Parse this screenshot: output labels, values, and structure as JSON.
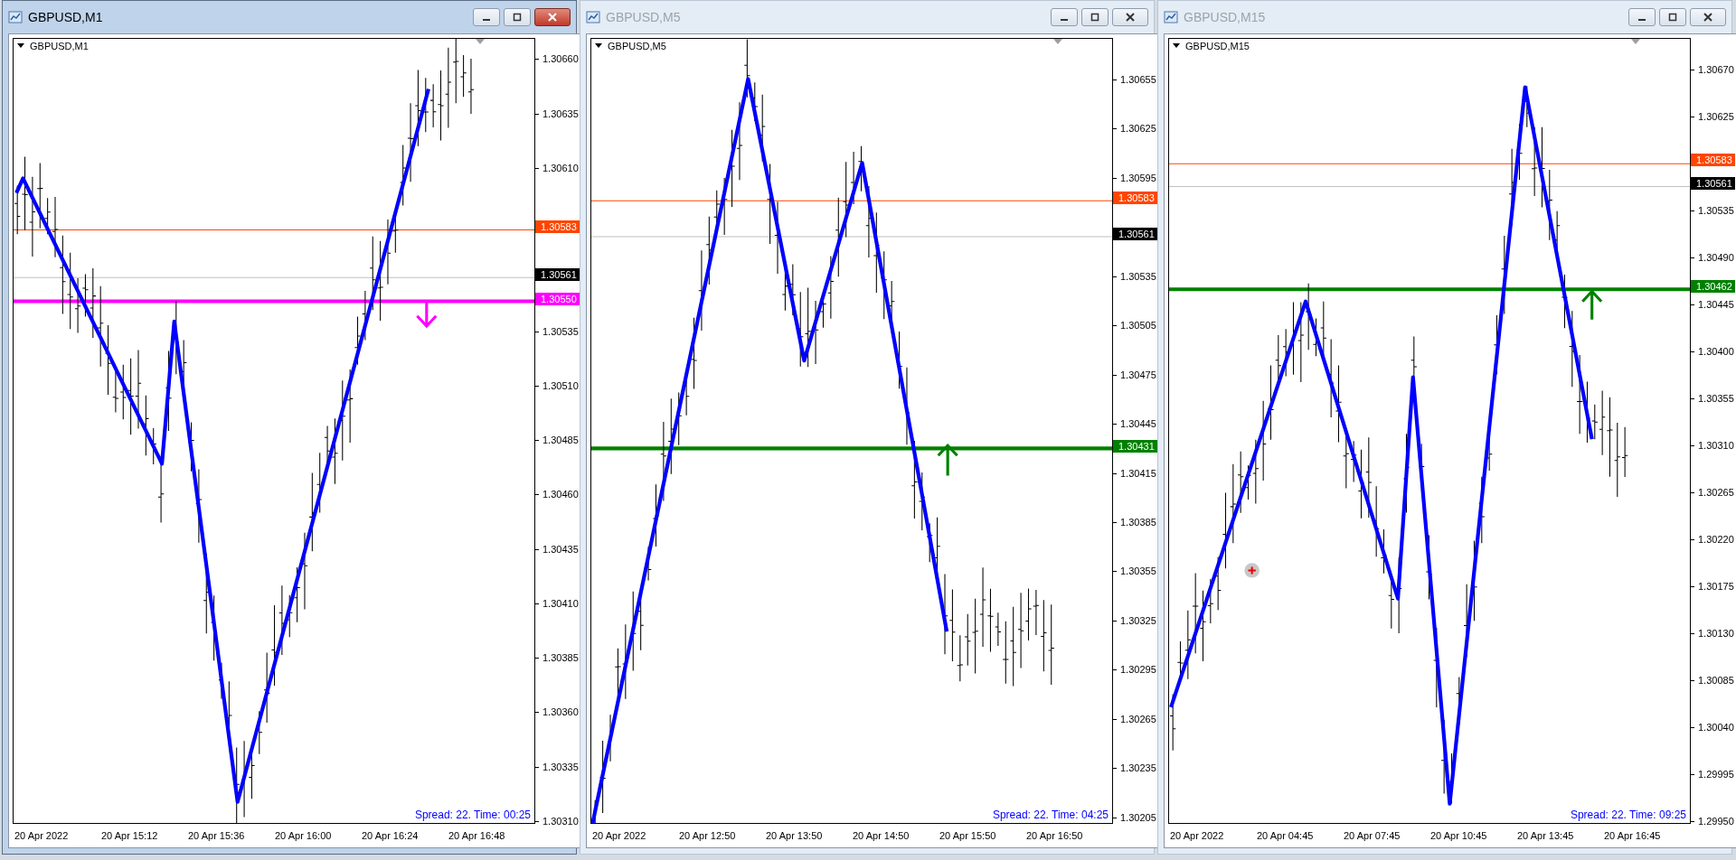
{
  "windows": [
    {
      "title": "GBPUSD,M1",
      "active": true,
      "symbol": "GBPUSD,M1",
      "ticks": [
        "1.30660",
        "1.30635",
        "1.30610",
        "1.30535",
        "1.30510",
        "1.30485",
        "1.30460",
        "1.30435",
        "1.30410",
        "1.30385",
        "1.30360",
        "1.30335",
        "1.30310"
      ],
      "price_lines": [
        {
          "kind": "ask",
          "label": "1.30583",
          "color": "#ff4500"
        },
        {
          "kind": "bid",
          "label": "1.30561",
          "color": "#000000"
        },
        {
          "kind": "level",
          "label": "1.30550",
          "color": "#ff00ff"
        }
      ],
      "time_labels": [
        "20 Apr 2022",
        "20 Apr 15:12",
        "20 Apr 15:36",
        "20 Apr 16:00",
        "20 Apr 16:24",
        "20 Apr 16:48"
      ],
      "spread_text": "Spread: 22. Time: 00:25"
    },
    {
      "title": "GBPUSD,M5",
      "active": false,
      "symbol": "GBPUSD,M5",
      "ticks": [
        "1.30655",
        "1.30625",
        "1.30595",
        "1.30535",
        "1.30505",
        "1.30475",
        "1.30445",
        "1.30415",
        "1.30385",
        "1.30355",
        "1.30325",
        "1.30295",
        "1.30265",
        "1.30235",
        "1.30205"
      ],
      "price_lines": [
        {
          "kind": "ask",
          "label": "1.30583",
          "color": "#ff4500"
        },
        {
          "kind": "bid",
          "label": "1.30561",
          "color": "#000000"
        },
        {
          "kind": "level",
          "label": "1.30431",
          "color": "#008000"
        }
      ],
      "time_labels": [
        "20 Apr 2022",
        "20 Apr 12:50",
        "20 Apr 13:50",
        "20 Apr 14:50",
        "20 Apr 15:50",
        "20 Apr 16:50"
      ],
      "spread_text": "Spread: 22. Time: 04:25"
    },
    {
      "title": "GBPUSD,M15",
      "active": false,
      "symbol": "GBPUSD,M15",
      "ticks": [
        "1.30670",
        "1.30625",
        "1.30535",
        "1.30490",
        "1.30445",
        "1.30400",
        "1.30355",
        "1.30310",
        "1.30265",
        "1.30220",
        "1.30175",
        "1.30130",
        "1.30085",
        "1.30040",
        "1.29995",
        "1.29950"
      ],
      "price_lines": [
        {
          "kind": "ask",
          "label": "1.30583",
          "color": "#ff4500"
        },
        {
          "kind": "bid",
          "label": "1.30561",
          "color": "#000000"
        },
        {
          "kind": "level",
          "label": "1.30462",
          "color": "#008000"
        }
      ],
      "time_labels": [
        "20 Apr 2022",
        "20 Apr 04:45",
        "20 Apr 07:45",
        "20 Apr 10:45",
        "20 Apr 13:45",
        "20 Apr 16:45"
      ],
      "spread_text": "Spread: 22. Time: 09:25"
    }
  ]
}
